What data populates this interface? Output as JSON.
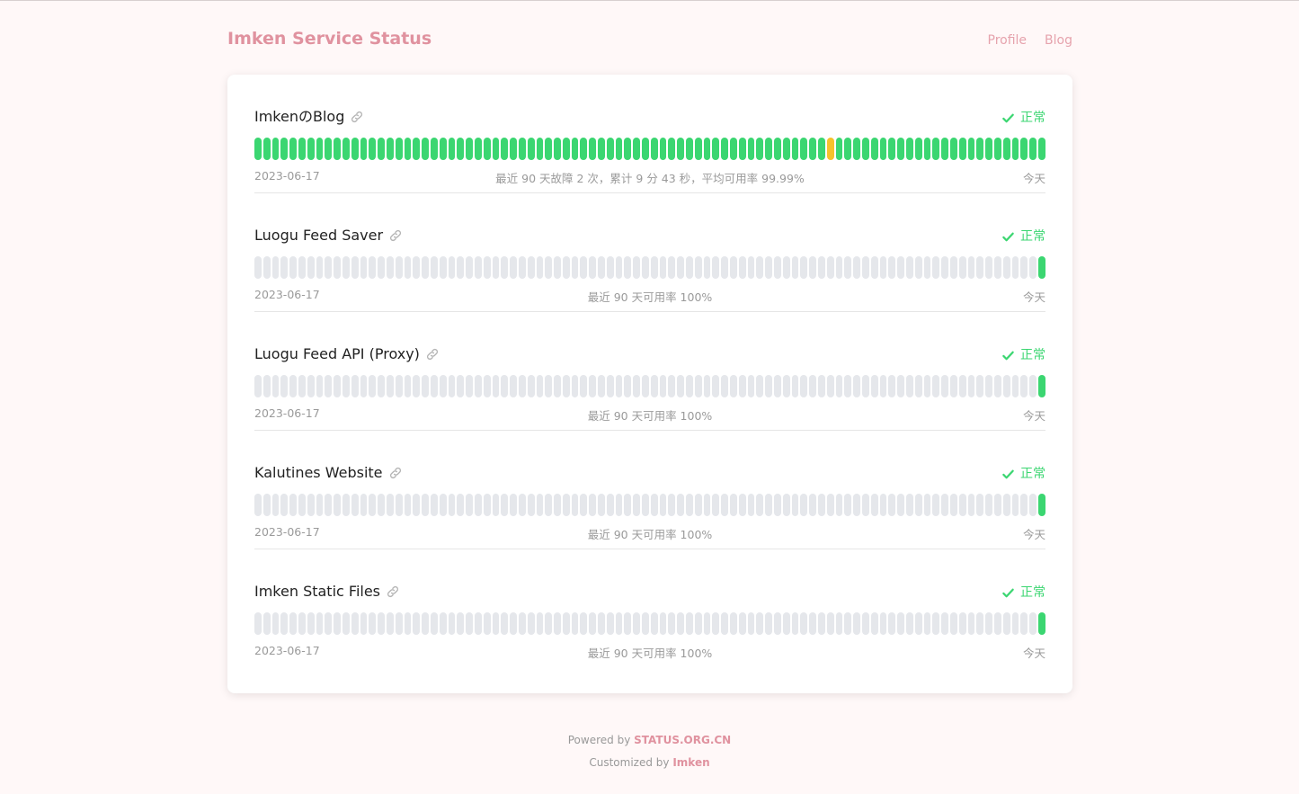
{
  "header": {
    "title": "Imken Service Status",
    "nav": [
      "Profile",
      "Blog"
    ]
  },
  "colors": {
    "brand": "#e0929f",
    "up": "#3bd671",
    "degraded": "#f6c22b",
    "nodata": "#e5e7eb"
  },
  "icons": {
    "link": "link-icon",
    "status": "check-icon"
  },
  "monitors": [
    {
      "name": "ImkenのBlog",
      "status": "正常",
      "start_date": "2023-06-17",
      "summary": "最近 90 天故障 2 次，累计 9 分 43 秒，平均可用率 99.99%",
      "end_label": "今天",
      "bars": {
        "count": 90,
        "nodata_days": 0,
        "warn_days": [
          65
        ]
      }
    },
    {
      "name": "Luogu Feed Saver",
      "status": "正常",
      "start_date": "2023-06-17",
      "summary": "最近 90 天可用率 100%",
      "end_label": "今天",
      "bars": {
        "count": 90,
        "nodata_days": 89,
        "warn_days": []
      }
    },
    {
      "name": "Luogu Feed API (Proxy)",
      "status": "正常",
      "start_date": "2023-06-17",
      "summary": "最近 90 天可用率 100%",
      "end_label": "今天",
      "bars": {
        "count": 90,
        "nodata_days": 89,
        "warn_days": []
      }
    },
    {
      "name": "Kalutines Website",
      "status": "正常",
      "start_date": "2023-06-17",
      "summary": "最近 90 天可用率 100%",
      "end_label": "今天",
      "bars": {
        "count": 90,
        "nodata_days": 89,
        "warn_days": []
      }
    },
    {
      "name": "Imken Static Files",
      "status": "正常",
      "start_date": "2023-06-17",
      "summary": "最近 90 天可用率 100%",
      "end_label": "今天",
      "bars": {
        "count": 90,
        "nodata_days": 89,
        "warn_days": []
      }
    }
  ],
  "footer": {
    "powered_prefix": "Powered by",
    "powered_name": "STATUS.ORG.CN",
    "custom_prefix": "Customized by",
    "custom_name": "Imken"
  }
}
